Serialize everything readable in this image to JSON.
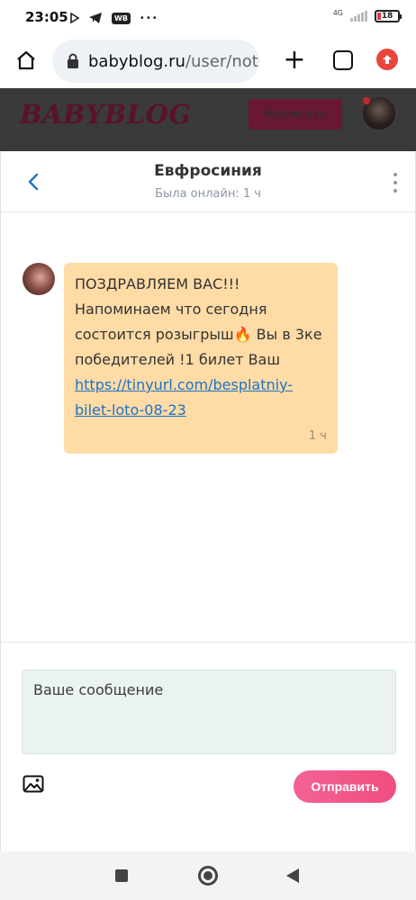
{
  "status_bar": {
    "time": "23:05",
    "network": "4G",
    "battery": "18",
    "left_icons": [
      "play-icon",
      "telegram-icon",
      "wb-icon",
      "more-dots-icon"
    ],
    "wb_label": "WB",
    "dots": "•••"
  },
  "browser": {
    "url_domain": "babyblog.ru",
    "url_path": "/user/not",
    "plus": "+"
  },
  "site_header": {
    "logo": "BABYBLOG",
    "write_button": "Написать"
  },
  "chat": {
    "contact_name": "Евфросиния",
    "contact_status": "Была онлайн: 1 ч",
    "message": {
      "text": "ПОЗДРАВЛЯЕМ ВАС!!! Напоминаем что сегодня состоится розыгрыш🔥 Вы в 3ке победителей !1 билет Ваш",
      "link": "https://tinyurl.com/besplatniy-bilet-loto-08-23",
      "time": "1 ч",
      "bubble_color": "#ffdba6"
    },
    "compose": {
      "placeholder": "Ваше сообщение",
      "send_button": "Отправить"
    }
  },
  "colors": {
    "accent": "#1a73c7",
    "send_button": "#f25b8a",
    "brand": "#6a1832"
  }
}
